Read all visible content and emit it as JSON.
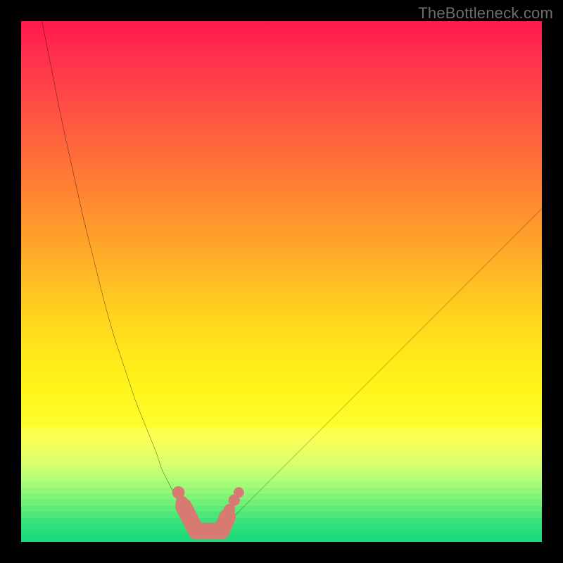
{
  "watermark": "TheBottleneck.com",
  "colors": {
    "frame": "#000000",
    "curve_stroke": "#000000",
    "marker_fill": "#d77a72",
    "marker_stroke": "#c55f57",
    "gradient_top": "#ff1a4d",
    "gradient_bottom_yellow": "#fdfd2e",
    "band_end": "#22e27a"
  },
  "bands": [
    "#feff4a",
    "#fbff52",
    "#f6ff5a",
    "#efff60",
    "#e6ff66",
    "#dcff6c",
    "#d0ff70",
    "#c3ff74",
    "#b4fd77",
    "#a4fb78",
    "#93f879",
    "#82f579",
    "#70f079",
    "#5eec79",
    "#4de779",
    "#3ce37a",
    "#2ee07a",
    "#24dd7a",
    "#1ddb7a"
  ],
  "chart_data": {
    "type": "line",
    "title": "",
    "xlabel": "",
    "ylabel": "",
    "xlim": [
      0,
      100
    ],
    "ylim": [
      0,
      100
    ],
    "series": [
      {
        "name": "left-branch",
        "x": [
          4,
          6,
          8,
          10,
          12,
          14,
          16,
          18,
          20,
          22,
          24,
          26,
          27,
          28,
          29,
          30,
          31,
          32,
          33,
          34
        ],
        "y": [
          100,
          90,
          80,
          71,
          62,
          54,
          46,
          39,
          33,
          27,
          22,
          17,
          14,
          12,
          10,
          8,
          6,
          4,
          3,
          2
        ]
      },
      {
        "name": "right-branch",
        "x": [
          38,
          39,
          40,
          42,
          44,
          46,
          50,
          54,
          58,
          62,
          66,
          70,
          74,
          78,
          82,
          86,
          90,
          94,
          98,
          100
        ],
        "y": [
          2,
          3,
          4,
          6,
          8,
          10,
          14,
          18,
          22,
          26,
          30,
          34,
          38,
          42,
          46,
          50,
          54,
          58,
          62,
          64
        ]
      },
      {
        "name": "valley-floor",
        "x": [
          34,
          35,
          36,
          37,
          38
        ],
        "y": [
          2,
          1.5,
          1.3,
          1.5,
          2
        ]
      }
    ],
    "markers": [
      {
        "x": 30.2,
        "y": 9.5,
        "r": 1.2
      },
      {
        "x": 30.9,
        "y": 7.6,
        "r": 1.2
      },
      {
        "x": 40.0,
        "y": 6.2,
        "r": 1.1
      },
      {
        "x": 40.9,
        "y": 8.0,
        "r": 1.1
      },
      {
        "x": 41.8,
        "y": 9.5,
        "r": 1.0
      }
    ],
    "valley_capsules": [
      {
        "x1": 31.2,
        "y1": 6.8,
        "x2": 33.6,
        "y2": 2.1,
        "r": 1.6
      },
      {
        "x1": 33.6,
        "y1": 2.1,
        "x2": 38.4,
        "y2": 2.1,
        "r": 1.6
      },
      {
        "x1": 38.4,
        "y1": 2.1,
        "x2": 39.6,
        "y2": 4.8,
        "r": 1.6
      }
    ]
  }
}
